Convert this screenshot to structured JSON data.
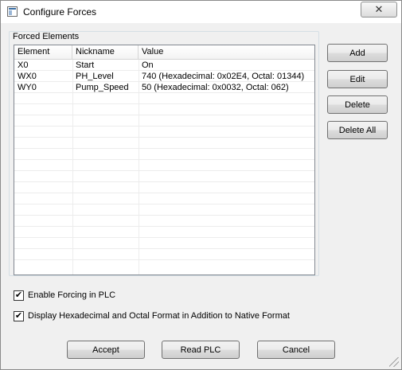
{
  "window": {
    "title": "Configure Forces",
    "close_glyph": "✕"
  },
  "forced_elements": {
    "group_label": "Forced Elements",
    "columns": [
      "Element",
      "Nickname",
      "Value"
    ],
    "rows": [
      {
        "element": "X0",
        "nickname": "Start",
        "value": "On"
      },
      {
        "element": "WX0",
        "nickname": "PH_Level",
        "value": "740  (Hexadecimal: 0x02E4, Octal: 01344)"
      },
      {
        "element": "WY0",
        "nickname": "Pump_Speed",
        "value": "50  (Hexadecimal: 0x0032, Octal: 062)"
      }
    ]
  },
  "side_buttons": {
    "add": "Add",
    "edit": "Edit",
    "delete": "Delete",
    "delete_all": "Delete All"
  },
  "options": {
    "enable_forcing": {
      "label": "Enable Forcing in PLC",
      "checked": true
    },
    "display_hex_octal": {
      "label": "Display Hexadecimal and Octal  Format in Addition to  Native Format",
      "checked": true
    }
  },
  "bottom_buttons": {
    "accept": "Accept",
    "read_plc": "Read PLC",
    "cancel": "Cancel"
  },
  "check_glyph": "✔"
}
